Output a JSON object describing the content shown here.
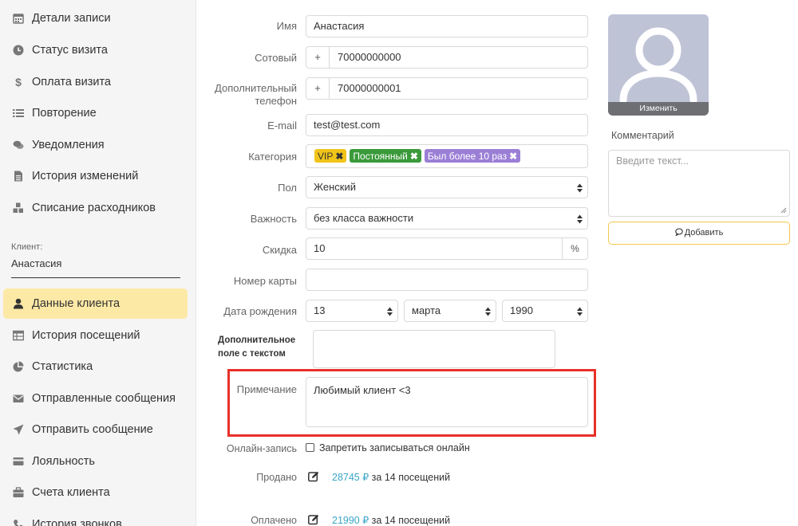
{
  "sidebar": {
    "items": [
      {
        "label": "Детали записи",
        "icon": "calendar-icon"
      },
      {
        "label": "Статус визита",
        "icon": "clock-icon"
      },
      {
        "label": "Оплата визита",
        "icon": "dollar-icon"
      },
      {
        "label": "Повторение",
        "icon": "list-icon"
      },
      {
        "label": "Уведомления",
        "icon": "chat-icon"
      },
      {
        "label": "История изменений",
        "icon": "document-icon"
      },
      {
        "label": "Списание расходников",
        "icon": "cubes-icon"
      }
    ],
    "client_label": "Клиент:",
    "client_name": "Анастасия",
    "client_items": [
      {
        "label": "Данные клиента",
        "icon": "user-icon",
        "active": true
      },
      {
        "label": "История посещений",
        "icon": "table-icon"
      },
      {
        "label": "Статистика",
        "icon": "pie-chart-icon"
      },
      {
        "label": "Отправленные сообщения",
        "icon": "envelope-icon"
      },
      {
        "label": "Отправить сообщение",
        "icon": "send-icon"
      },
      {
        "label": "Лояльность",
        "icon": "card-icon"
      },
      {
        "label": "Счета клиента",
        "icon": "briefcase-icon"
      },
      {
        "label": "История звонков",
        "icon": "phone-icon"
      }
    ]
  },
  "form": {
    "name": {
      "label": "Имя",
      "value": "Анастасия"
    },
    "mobile": {
      "label": "Сотовый",
      "prefix": "+",
      "value": "70000000000"
    },
    "extra_phone": {
      "label_line1": "Дополнительный",
      "label_line2": "телефон",
      "prefix": "+",
      "value": "70000000001"
    },
    "email": {
      "label": "E-mail",
      "value": "test@test.com"
    },
    "category": {
      "label": "Категория",
      "tags": [
        {
          "text": "VIP",
          "bg": "#f0c419",
          "fg": "#333333"
        },
        {
          "text": "Постоянный",
          "bg": "#3a9a3a",
          "fg": "#ffffff"
        },
        {
          "text": "Был более 10 раз",
          "bg": "#9b7fd6",
          "fg": "#ffffff"
        }
      ]
    },
    "gender": {
      "label": "Пол",
      "value": "Женский"
    },
    "importance": {
      "label": "Важность",
      "value": "без класса важности"
    },
    "discount": {
      "label": "Скидка",
      "value": "10",
      "suffix": "%"
    },
    "card": {
      "label": "Номер карты",
      "value": ""
    },
    "birthday": {
      "label": "Дата рождения",
      "day": "13",
      "month": "марта",
      "year": "1990"
    },
    "extra_field": {
      "label_line1": "Дополнительное",
      "label_line2": "поле с текстом",
      "value": ""
    },
    "note": {
      "label": "Примечание",
      "value": "Любимый клиент <3"
    },
    "online": {
      "label": "Онлайн-запись",
      "checkbox_label": "Запретить записываться онлайн"
    },
    "sold": {
      "label": "Продано",
      "amount": "28745 ₽",
      "suffix": "за 14 посещений"
    },
    "paid": {
      "label": "Оплачено",
      "amount": "21990 ₽",
      "suffix": "за 14 посещений"
    }
  },
  "side_panel": {
    "change_photo": "Изменить",
    "comment_title": "Комментарий",
    "comment_placeholder": "Введите текст...",
    "add_button": "Добавить"
  },
  "colors": {
    "active_bg": "#fde9a6",
    "highlight": "#e8302a",
    "accent": "#f2c94c",
    "money": "#3aa6c9"
  }
}
